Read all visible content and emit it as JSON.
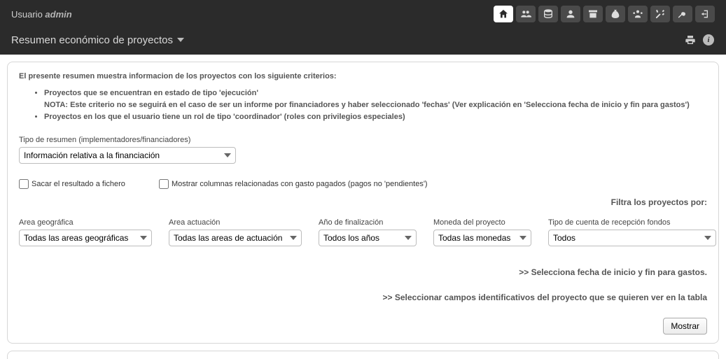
{
  "header": {
    "user_prefix": "Usuario",
    "username": "admin",
    "page_title": "Resumen económico de proyectos"
  },
  "intro": {
    "lead": "El presente resumen muestra informacion de los proyectos con los siguiente criterios:",
    "bullet1_line1": "Proyectos que se encuentran en estado de tipo 'ejecución'",
    "bullet1_line2": "NOTA: Este criterio no se seguirá en el caso de ser un informe por financiadores y haber seleccionado 'fechas' (Ver explicación en 'Selecciona fecha de inicio y fin para gastos')",
    "bullet2": "Proyectos en los que el usuario tiene un rol de tipo 'coordinador' (roles con privilegios especiales)"
  },
  "tipo_resumen": {
    "label": "Tipo de resumen (implementadores/financiadores)",
    "value": "Información relativa a la financiación"
  },
  "checks": {
    "sacar_fichero": "Sacar el resultado a fichero",
    "mostrar_columnas": "Mostrar columnas relacionadas con gasto pagados (pagos no 'pendientes')"
  },
  "filter_title": "Filtra los proyectos por:",
  "filters": {
    "area_geo": {
      "label": "Area geográfica",
      "value": "Todas las areas geográficas"
    },
    "area_act": {
      "label": "Area actuación",
      "value": "Todas las areas de actuación"
    },
    "anio_fin": {
      "label": "Año de finalización",
      "value": "Todos los años"
    },
    "moneda": {
      "label": "Moneda del proyecto",
      "value": "Todas las monedas"
    },
    "cuenta": {
      "label": "Tipo de cuenta de recepción fondos",
      "value": "Todos"
    }
  },
  "links": {
    "fechas": ">> Selecciona fecha de inicio y fin para gastos.",
    "campos": ">> Seleccionar campos identificativos del proyecto que se quieren ver en la tabla"
  },
  "buttons": {
    "mostrar": "Mostrar"
  }
}
